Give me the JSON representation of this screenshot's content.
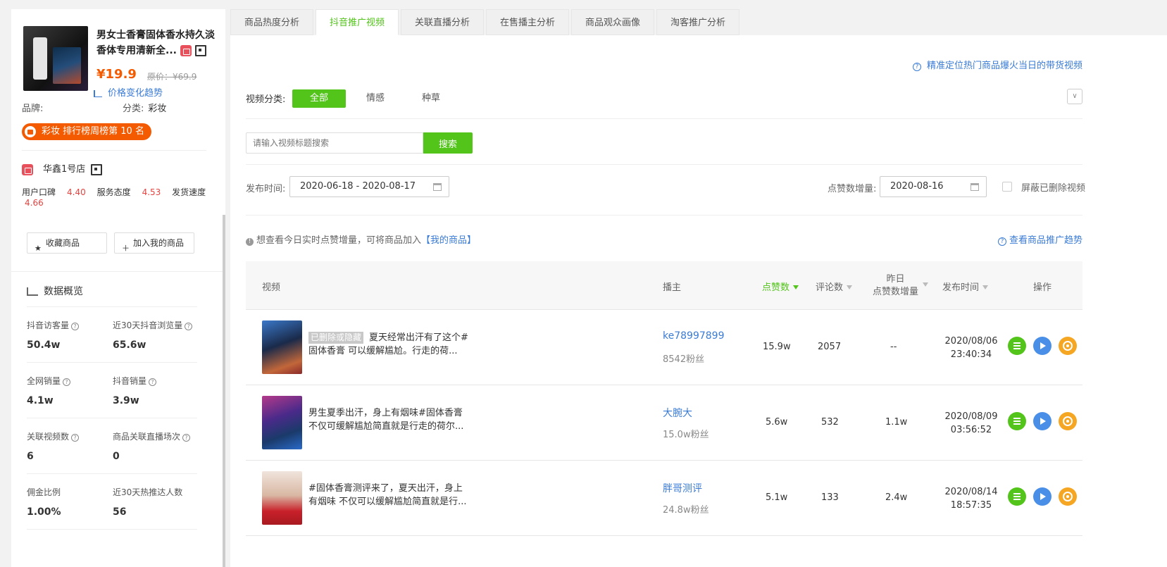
{
  "product": {
    "name": "男女士香膏固体香水持久淡香体专用清新全...",
    "price": "¥19.9",
    "original_price": "原价：¥69.9",
    "trend_link": "价格变化趋势",
    "brand_label": "品牌:",
    "category_label": "分类:",
    "category_value": "彩妆",
    "rank_badge": "彩妆 排行榜周榜第 10 名"
  },
  "store": {
    "name": "华鑫1号店",
    "scores": [
      {
        "label": "用户口碑",
        "value": "4.40"
      },
      {
        "label": "服务态度",
        "value": "4.53"
      },
      {
        "label": "发货速度",
        "value": "4.66"
      }
    ]
  },
  "actions": {
    "favorite": "收藏商品",
    "add_mine": "加入我的商品"
  },
  "overview": {
    "title": "数据概览",
    "stats": [
      {
        "label": "抖音访客量",
        "value": "50.4w"
      },
      {
        "label": "近30天抖音浏览量",
        "value": "65.6w"
      },
      {
        "label": "全网销量",
        "value": "4.1w"
      },
      {
        "label": "抖音销量",
        "value": "3.9w"
      },
      {
        "label": "关联视频数",
        "value": "6"
      },
      {
        "label": "商品关联直播场次",
        "value": "0"
      },
      {
        "label": "佣金比例",
        "value": "1.00%"
      },
      {
        "label": "近30天热推达人数",
        "value": "56"
      }
    ]
  },
  "tabs": [
    "商品热度分析",
    "抖音推广视频",
    "关联直播分析",
    "在售播主分析",
    "商品观众画像",
    "淘客推广分析"
  ],
  "active_tab": "抖音推广视频",
  "help_top": "精准定位热门商品爆火当日的带货视频",
  "filter": {
    "category_label": "视频分类:",
    "categories": [
      "全部",
      "情感",
      "种草"
    ],
    "search_placeholder": "请输入视频标题搜索",
    "search_button": "搜索",
    "publish_label": "发布时间:",
    "publish_range": "2020-06-18 - 2020-08-17",
    "likes_label": "点赞数增量:",
    "likes_date": "2020-08-16",
    "hide_deleted": "屏蔽已删除视频"
  },
  "tip": {
    "text": "想查看今日实时点赞增量，可将商品加入",
    "link": "【我的商品】"
  },
  "trend_link": "查看商品推广趋势",
  "table": {
    "headers": {
      "video": "视频",
      "anchor": "播主",
      "likes": "点赞数",
      "comments": "评论数",
      "yesterday_1": "昨日",
      "yesterday_2": "点赞数增量",
      "time": "发布时间",
      "ops": "操作"
    },
    "rows": [
      {
        "badge": "已删除或隐藏",
        "title": "夏天经常出汗有了这个#固体香膏 可以缓解尴尬。行走的荷...",
        "anchor": "ke78997899",
        "fans": "8542粉丝",
        "likes": "15.9w",
        "comments": "2057",
        "yesterday": "--",
        "date": "2020/08/06",
        "time": "23:40:34"
      },
      {
        "badge": "",
        "title": "男生夏季出汗，身上有烟味#固体香膏 不仅可缓解尴尬简直就是行走的荷尔...",
        "anchor": "大腕大",
        "fans": "15.0w粉丝",
        "likes": "5.6w",
        "comments": "532",
        "yesterday": "1.1w",
        "date": "2020/08/09",
        "time": "03:56:52"
      },
      {
        "badge": "",
        "title": "#固体香膏测评来了，夏天出汗，身上有烟味 不仅可以缓解尴尬简直就是行...",
        "anchor": "胖哥测评",
        "fans": "24.8w粉丝",
        "likes": "5.1w",
        "comments": "133",
        "yesterday": "2.4w",
        "date": "2020/08/14",
        "time": "18:57:35"
      }
    ]
  },
  "colors": {
    "accent_green": "#52c41a",
    "link_blue": "#3a7bd5",
    "price_orange": "#f45a00",
    "score_red": "#e64340"
  }
}
